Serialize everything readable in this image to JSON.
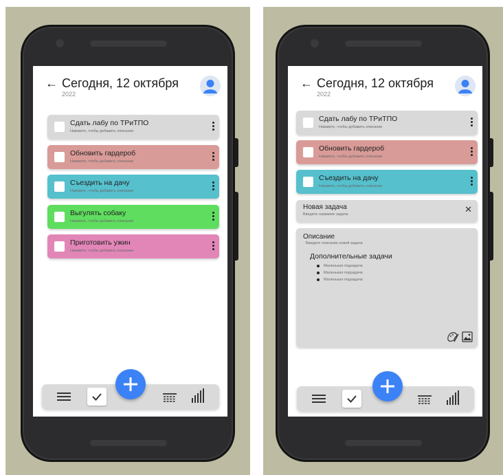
{
  "colors": {
    "background": "#bdbca2",
    "fab": "#3b82f6",
    "task_gray": "#d9d9d9",
    "task_red": "#d99b98",
    "task_teal": "#56c0cd",
    "task_green": "#5fdd5f",
    "task_pink": "#e286b8"
  },
  "left": {
    "header": {
      "back_icon": "←",
      "title": "Сегодня, 12 октября",
      "year": "2022"
    },
    "tasks": [
      {
        "name": "Сдать лабу по ТРиТПО",
        "hint": "Нажмите, чтобы добавить описание",
        "color": "#d9d9d9"
      },
      {
        "name": "Обновить гардероб",
        "hint": "Нажмите, чтобы добавить описание",
        "color": "#d99b98"
      },
      {
        "name": "Съездить на дачу",
        "hint": "Нажмите, чтобы добавить описание",
        "color": "#56c0cd"
      },
      {
        "name": "Выгулять собаку",
        "hint": "Нажмите, чтобы добавить описание",
        "color": "#5fdd5f"
      },
      {
        "name": "Приготовить ужин",
        "hint": "Нажмите, чтобы добавить описание",
        "color": "#e286b8"
      }
    ]
  },
  "right": {
    "header": {
      "back_icon": "←",
      "title": "Сегодня, 12 октября",
      "year": "2022"
    },
    "tasks": [
      {
        "name": "Сдать лабу по ТРиТПО",
        "hint": "Нажмите, чтобы добавить описание",
        "color": "#d9d9d9"
      },
      {
        "name": "Обновить гардероб",
        "hint": "Нажмите, чтобы добавить описание",
        "color": "#d99b98"
      },
      {
        "name": "Съездить на дачу",
        "hint": "Нажмите, чтобы добавить описание",
        "color": "#56c0cd"
      }
    ],
    "new_task": {
      "title": "Новая задача",
      "hint": "Введите название задачи",
      "close_icon": "✕"
    },
    "description": {
      "title": "Описание",
      "hint": "Введите описание новой задачи",
      "subtasks_title": "Дополнительные задачи",
      "subtasks": [
        "Маленькая подзадача",
        "Маленькая подзадача",
        "Маленькая подзадача"
      ]
    }
  },
  "icons": {
    "menu": "menu-icon",
    "check": "check-icon",
    "add": "plus-icon",
    "calendar": "calendar-icon",
    "stats": "bar-chart-icon",
    "avatar": "user-avatar-icon",
    "paint": "paint-palette-icon",
    "image": "image-icon"
  }
}
